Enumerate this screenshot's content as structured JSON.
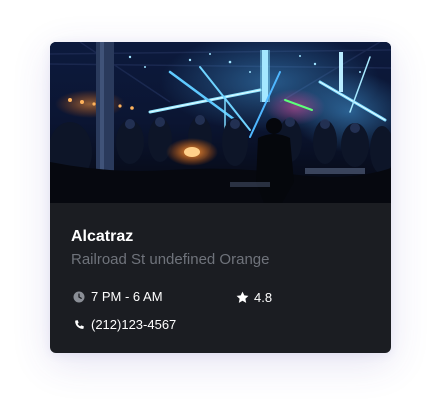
{
  "card": {
    "name": "Alcatraz",
    "address": "Railroad St undefined Orange",
    "hours": "7 PM - 6 AM",
    "rating": "4.8",
    "phone": "(212)123-4567",
    "image_alt": "Nightclub interior with blue lights"
  },
  "icons": {
    "hours": "clock-icon",
    "rating": "star-icon",
    "phone": "phone-icon"
  },
  "colors": {
    "card_background": "#1b1d22",
    "title": "#ffffff",
    "address": "#6f737b",
    "meta_text": "#ffffff"
  }
}
